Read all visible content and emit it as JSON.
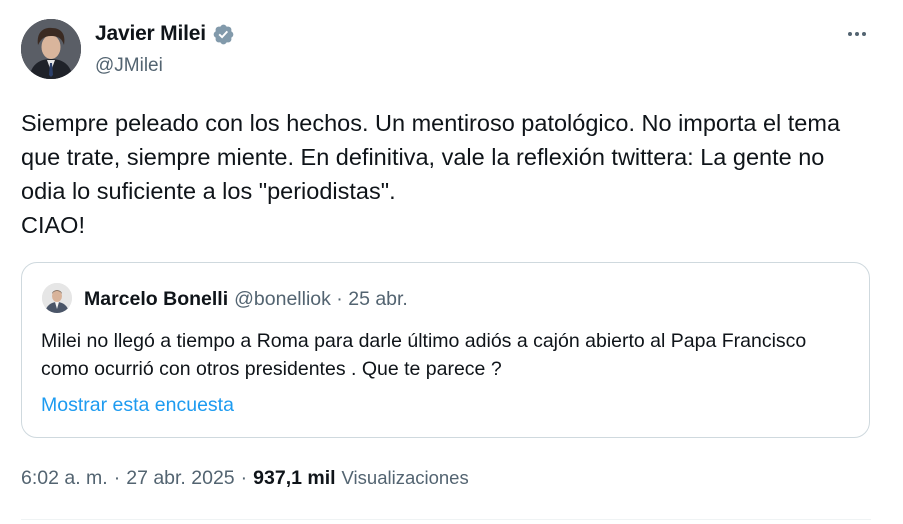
{
  "author": {
    "display_name": "Javier Milei",
    "handle": "@JMilei",
    "verified": true,
    "verified_color": "#829aab"
  },
  "tweet": {
    "text": "Siempre peleado con los hechos. Un mentiroso patológico. No importa el tema que trate, siempre miente. En definitiva, vale la reflexión twittera: La gente no odia lo suficiente a los \"periodistas\".\nCIAO!"
  },
  "quote": {
    "display_name": "Marcelo Bonelli",
    "meta": "@bonelliok · 25 abr.",
    "text": "Milei no llegó a tiempo a Roma para darle último adiós a cajón abierto al Papa Francisco como ocurrió con otros presidentes . Que te parece ?",
    "poll_link": "Mostrar esta encuesta"
  },
  "meta": {
    "time": "6:02 a. m.",
    "separator": "·",
    "date": "27 abr. 2025",
    "views_count": "937,1 mil",
    "views_label": "Visualizaciones"
  },
  "icons": {
    "more": "more-horizontal-icon",
    "verified": "verified-badge-icon"
  },
  "colors": {
    "text": "#0f1419",
    "secondary": "#536471",
    "link": "#1d9bf0",
    "border": "#cfd9de"
  }
}
